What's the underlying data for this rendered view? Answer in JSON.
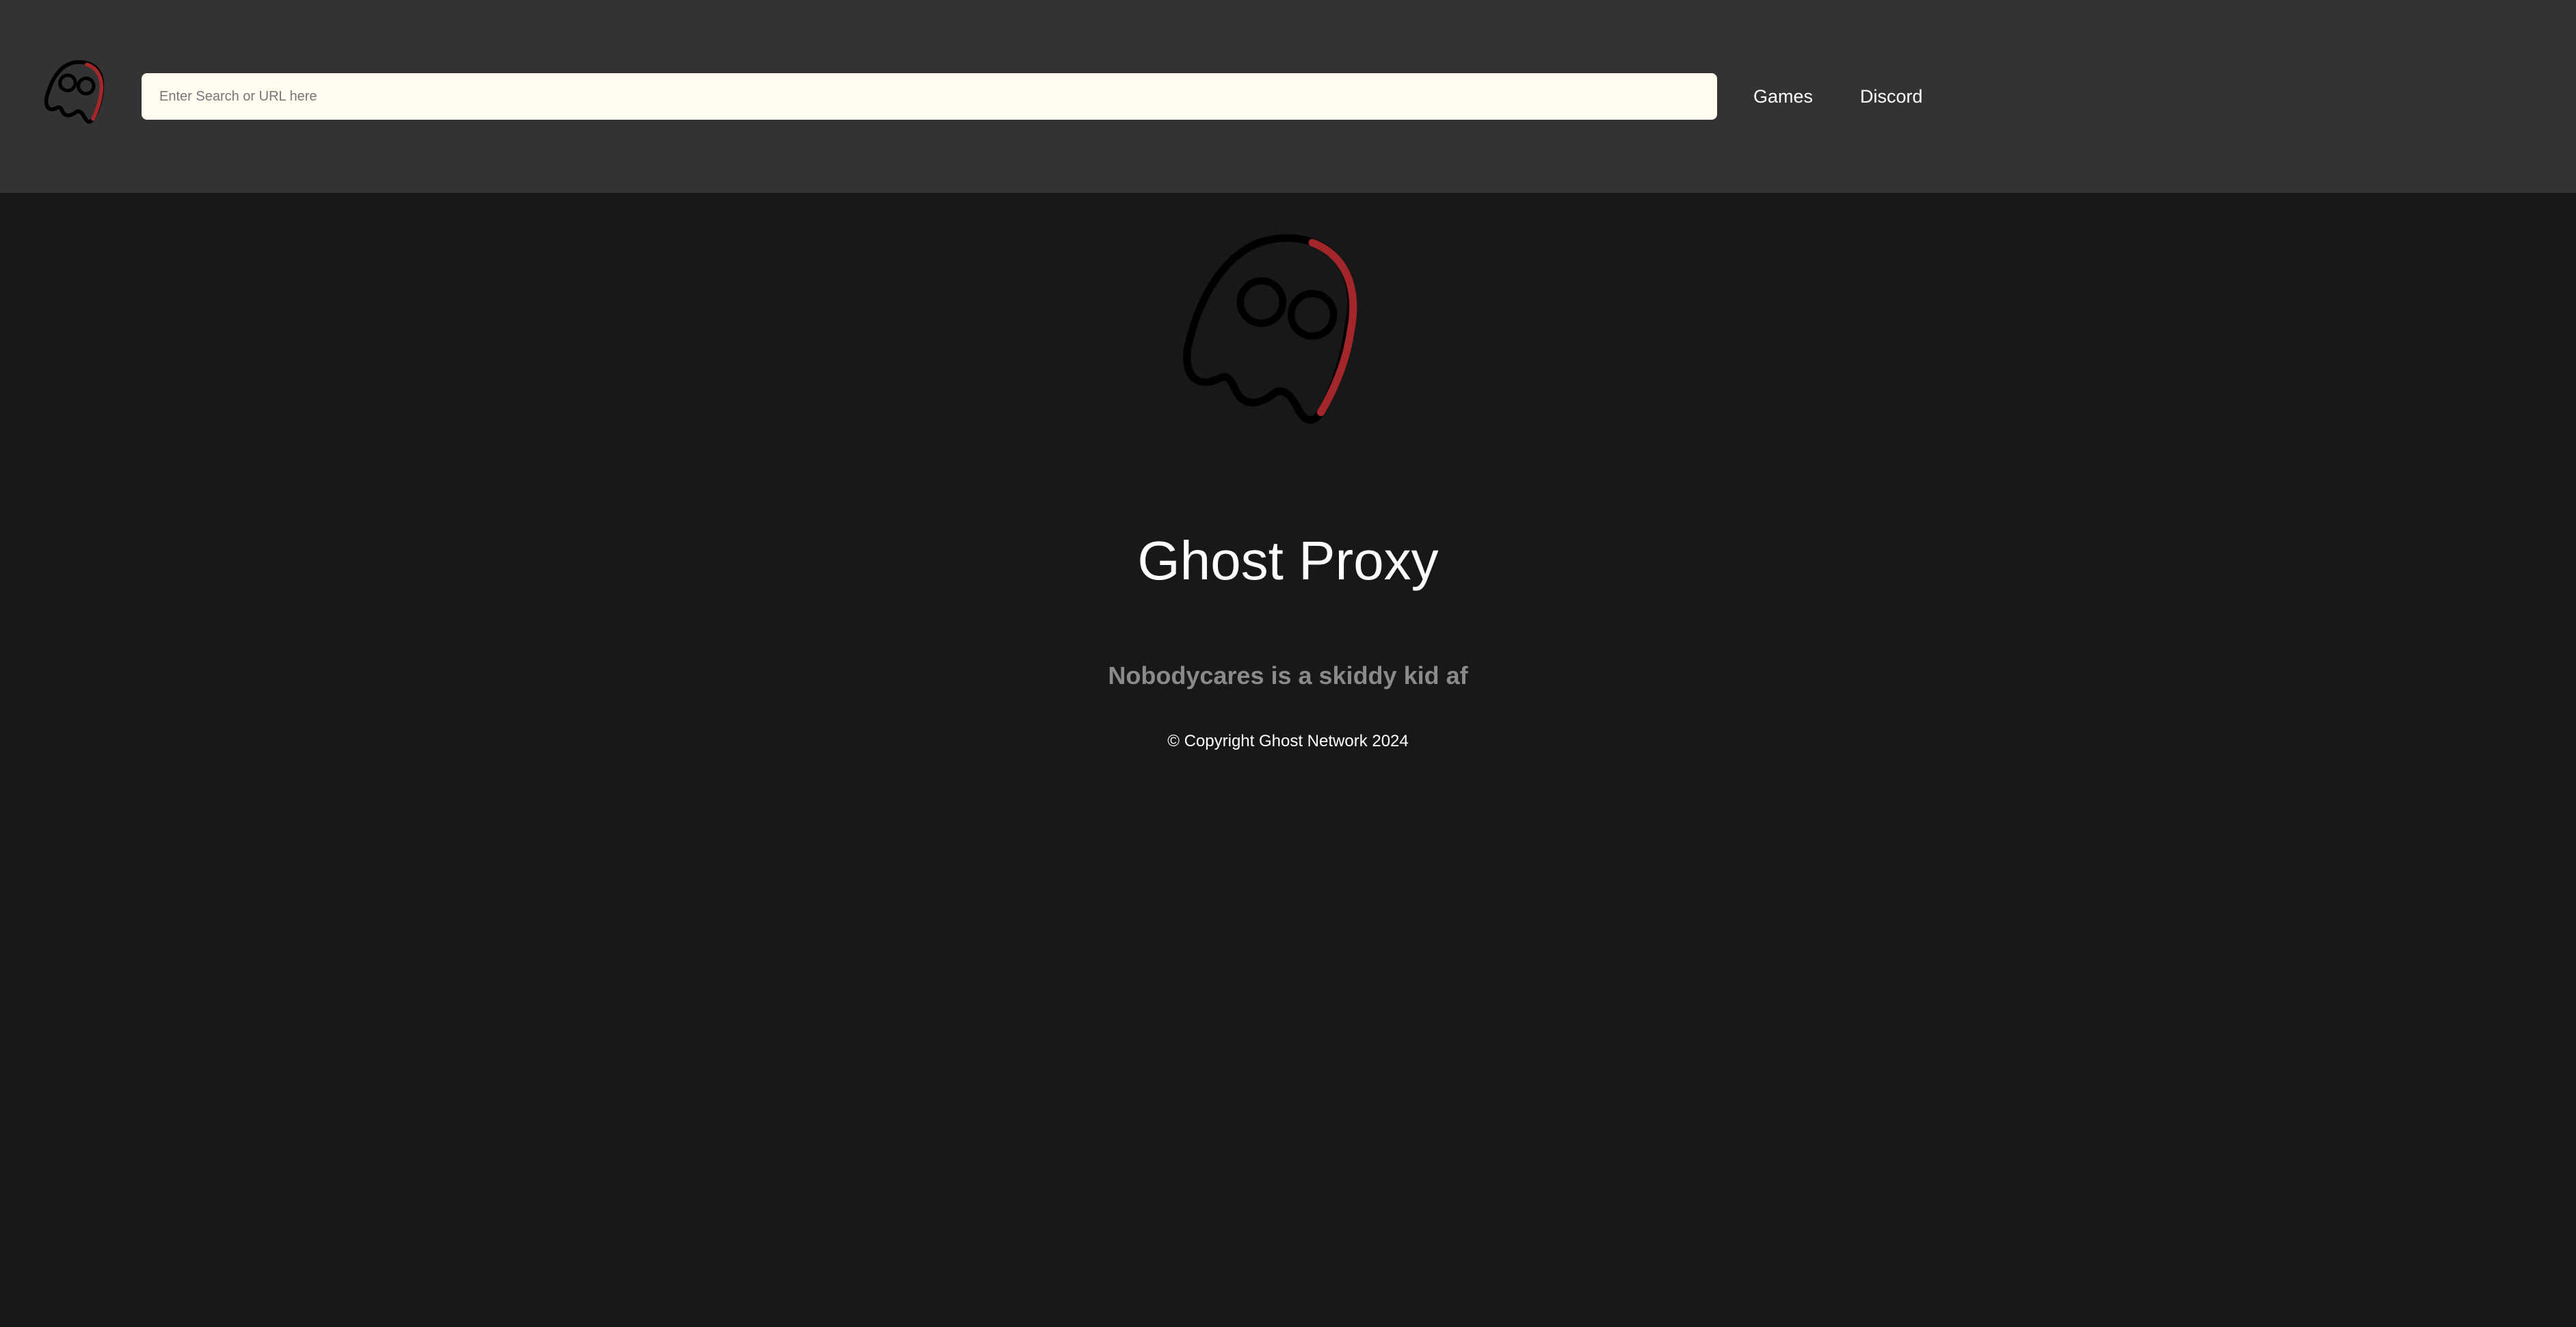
{
  "header": {
    "logo_icon": "ghost-logo-icon",
    "search": {
      "value": "",
      "placeholder": "Enter Search or URL here"
    },
    "nav": {
      "games_label": "Games",
      "discord_label": "Discord"
    }
  },
  "main": {
    "logo_icon": "ghost-logo-icon",
    "title": "Ghost Proxy",
    "tagline": "Nobodycares is a skiddy kid af",
    "copyright": "© Copyright Ghost Network 2024"
  },
  "colors": {
    "header_bg": "#333333",
    "page_bg": "#181818",
    "search_bg": "#fffcf0",
    "logo_accent": "#a3262a",
    "logo_outline": "#000000",
    "tagline": "#8a8a8a",
    "text": "#ffffff"
  }
}
